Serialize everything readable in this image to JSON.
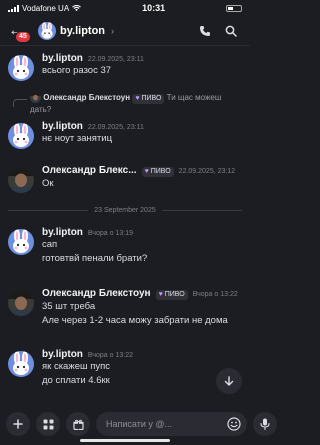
{
  "status_bar": {
    "carrier": "Vodafone UA",
    "time": "10:31"
  },
  "header": {
    "back_badge": "45",
    "title": "by.lipton"
  },
  "date_divider": "23 September 2025",
  "messages": [
    {
      "author": "by.lipton",
      "time": "22.09.2025, 23:11",
      "lines": [
        "всього разос 37"
      ]
    },
    {
      "reply": {
        "author": "Олександр Блекстоун",
        "tag": "ПИВО",
        "text": "Ти щас можеш дать?"
      },
      "author": "by.lipton",
      "time": "22.09.2025, 23:11",
      "lines": [
        "нє ноут занятиц"
      ]
    },
    {
      "author": "Олександр Блекс...",
      "tag": "ПИВО",
      "time": "22.09.2025, 23:12",
      "lines": [
        "Ок"
      ]
    },
    {
      "author": "by.lipton",
      "time": "Вчора о 13:19",
      "lines": [
        "сап",
        "готовтвй пенали брати?"
      ]
    },
    {
      "author": "Олександр Блекстоун",
      "tag": "ПИВО",
      "time": "Вчора о 13:22",
      "lines": [
        "35 шт треба",
        "Але через 1-2 часа можу забрати не дома"
      ]
    },
    {
      "author": "by.lipton",
      "time": "Вчора о 13:22",
      "lines": [
        "як скажеш пупс",
        "до сплати 4.6кк"
      ]
    }
  ],
  "composer": {
    "placeholder": "Написати у @..."
  },
  "icons": {
    "back": "arrow-left-icon",
    "call": "phone-icon",
    "search": "search-icon",
    "plus": "plus-icon",
    "apps": "apps-icon",
    "gift": "gift-icon",
    "emoji": "emoji-icon",
    "mic": "microphone-icon",
    "scroll": "chevron-down-icon"
  },
  "colors": {
    "background": "#1c1d22",
    "badge": "#e0383e",
    "tag_heart": "#c49cff",
    "bubble": "#2b2c33"
  }
}
